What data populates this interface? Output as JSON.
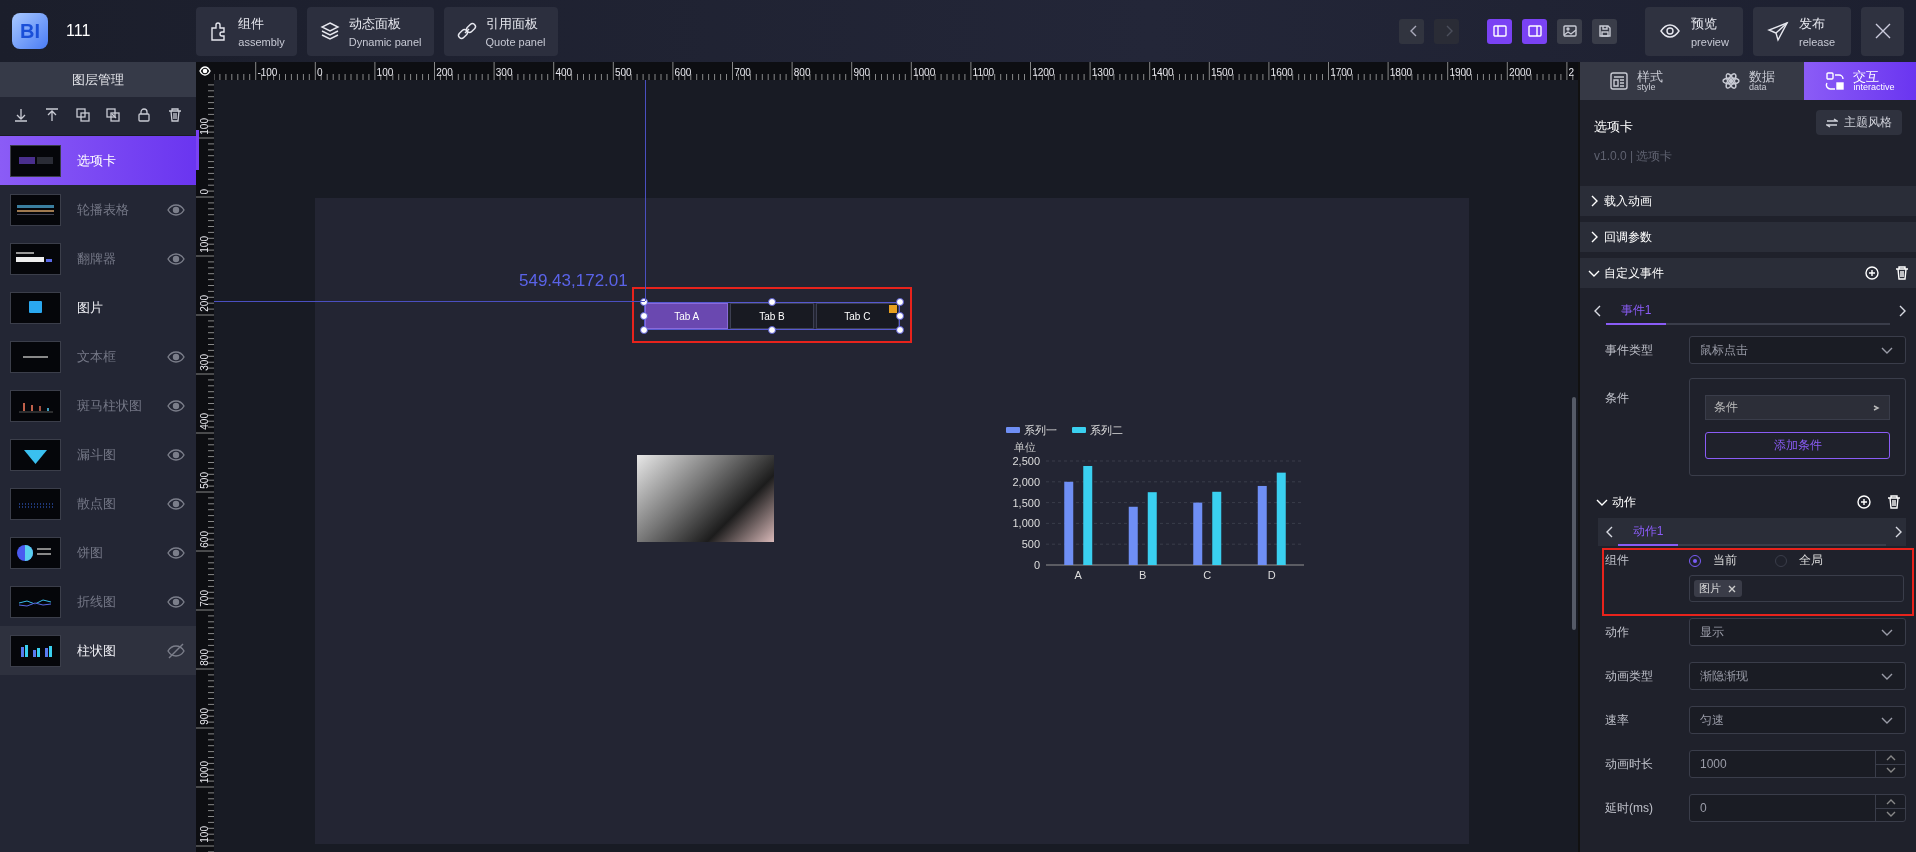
{
  "app": {
    "logo": "BI",
    "title": "111"
  },
  "toolbar": [
    {
      "label": "组件",
      "sublabel": "assembly",
      "kind": "puzzle"
    },
    {
      "label": "动态面板",
      "sublabel": "Dynamic panel",
      "kind": "layers"
    },
    {
      "label": "引用面板",
      "sublabel": "Quote panel",
      "kind": "link"
    }
  ],
  "nav": [
    {
      "kind": "back",
      "disabled": false
    },
    {
      "kind": "forward",
      "disabled": true
    }
  ],
  "toggles": [
    {
      "kind": "left-panel",
      "on": true
    },
    {
      "kind": "right-panel",
      "on": true
    },
    {
      "kind": "image",
      "on": false
    },
    {
      "kind": "save",
      "on": false
    }
  ],
  "actions": [
    {
      "label": "预览",
      "sublabel": "preview",
      "kind": "eye"
    },
    {
      "label": "发布",
      "sublabel": "release",
      "kind": "send"
    }
  ],
  "layers": {
    "title": "图层管理",
    "items": [
      {
        "name": "选项卡",
        "kind": "tabs",
        "selected": true,
        "hidden": false,
        "hovered": false
      },
      {
        "name": "轮播表格",
        "kind": "table",
        "selected": false,
        "hidden": true,
        "hovered": false
      },
      {
        "name": "翻牌器",
        "kind": "counter",
        "selected": false,
        "hidden": true,
        "hovered": false
      },
      {
        "name": "图片",
        "kind": "image",
        "selected": false,
        "hidden": false,
        "hovered": false
      },
      {
        "name": "文本框",
        "kind": "text",
        "selected": false,
        "hidden": true,
        "hovered": false
      },
      {
        "name": "斑马柱状图",
        "kind": "bars",
        "selected": false,
        "hidden": true,
        "hovered": false
      },
      {
        "name": "漏斗图",
        "kind": "funnel",
        "selected": false,
        "hidden": true,
        "hovered": false
      },
      {
        "name": "散点图",
        "kind": "scatter",
        "selected": false,
        "hidden": true,
        "hovered": false
      },
      {
        "name": "饼图",
        "kind": "pie",
        "selected": false,
        "hidden": true,
        "hovered": false
      },
      {
        "name": "折线图",
        "kind": "line",
        "selected": false,
        "hidden": true,
        "hovered": false
      },
      {
        "name": "柱状图",
        "kind": "bars2",
        "selected": false,
        "hidden": false,
        "hovered": true
      }
    ]
  },
  "ruler": {
    "x_labels": [
      "-100",
      "0",
      "100",
      "200",
      "300",
      "400",
      "500",
      "600",
      "700",
      "800",
      "900",
      "1000",
      "1100",
      "1200",
      "1300",
      "1400",
      "1500",
      "1600",
      "1700",
      "1800",
      "1900",
      "2000",
      "2"
    ],
    "y_labels": [
      "100",
      "0",
      "100",
      "200",
      "300",
      "400",
      "500",
      "600",
      "700",
      "800",
      "900",
      "1000",
      "100"
    ]
  },
  "canvas": {
    "cursor_readout": "549.43,172.01",
    "tabs": [
      {
        "label": "Tab A",
        "selected": true
      },
      {
        "label": "Tab B",
        "selected": false
      },
      {
        "label": "Tab C",
        "selected": false
      }
    ],
    "chart_data": {
      "type": "bar",
      "ylabel": "单位",
      "categories": [
        "A",
        "B",
        "C",
        "D"
      ],
      "series": [
        {
          "name": "系列一",
          "color": "#6f8ff5",
          "values": [
            2000,
            1400,
            1500,
            1900
          ]
        },
        {
          "name": "系列二",
          "color": "#3ad0f0",
          "values": [
            2380,
            1750,
            1760,
            2220
          ]
        }
      ],
      "legend": true,
      "grid": true,
      "ylim": [
        0,
        2500
      ],
      "yticks": [
        {
          "value": 0,
          "label": "0"
        },
        {
          "value": 500,
          "label": "500"
        },
        {
          "value": 1000,
          "label": "1,000"
        },
        {
          "value": 1500,
          "label": "1,500"
        },
        {
          "value": 2000,
          "label": "2,000"
        },
        {
          "value": 2500,
          "label": "2,500"
        }
      ]
    }
  },
  "inspector": {
    "tabs": [
      {
        "label": "样式",
        "sublabel": "style",
        "kind": "style",
        "selected": false
      },
      {
        "label": "数据",
        "sublabel": "data",
        "kind": "data",
        "selected": false
      },
      {
        "label": "交互",
        "sublabel": "interactive",
        "kind": "interactive",
        "selected": true
      }
    ],
    "component_name": "选项卡",
    "version": "v1.0.0 | 选项卡",
    "theme_button": "主题风格",
    "sections": [
      {
        "title": "载入动画",
        "expanded": false
      },
      {
        "title": "回调参数",
        "expanded": false
      }
    ],
    "custom_events": {
      "title": "自定义事件",
      "expanded": true,
      "tabs": [
        {
          "label": "事件1",
          "selected": true
        }
      ],
      "event_type": {
        "label": "事件类型",
        "value": "鼠标点击"
      },
      "conditions": {
        "label": "条件",
        "items": [
          "条件"
        ],
        "add_button": "添加条件"
      },
      "actions": {
        "title": "动作",
        "expanded": true,
        "tabs": [
          {
            "label": "动作1",
            "selected": true
          }
        ],
        "target": {
          "label": "组件",
          "options": [
            {
              "label": "当前",
              "selected": true
            },
            {
              "label": "全局",
              "selected": false
            }
          ],
          "tags": [
            "图片"
          ]
        },
        "fields": [
          {
            "label": "动作",
            "kind": "select",
            "value": "显示"
          },
          {
            "label": "动画类型",
            "kind": "select",
            "value": "渐隐渐现"
          },
          {
            "label": "速率",
            "kind": "select",
            "value": "匀速"
          },
          {
            "label": "动画时长",
            "kind": "number",
            "value": "1000"
          },
          {
            "label": "延时(ms)",
            "kind": "number",
            "value": "0"
          }
        ]
      }
    }
  }
}
